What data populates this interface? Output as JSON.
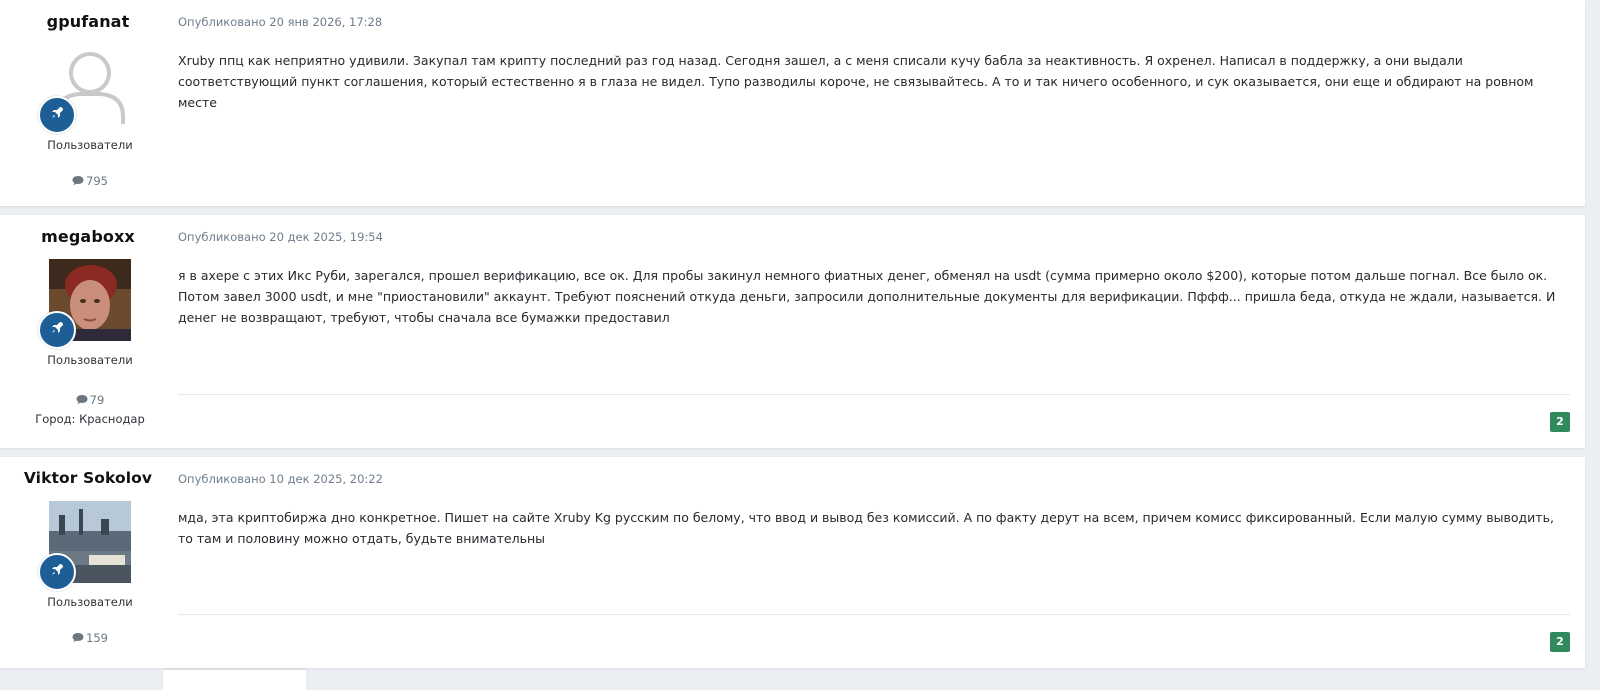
{
  "posts": [
    {
      "author": "gpufanat",
      "avatar": "default-avatar",
      "badge_icon": "rocket-icon",
      "group": "Пользователи",
      "post_count": "795",
      "city": "",
      "date": "Опубликовано 20 янв 2026, 17:28",
      "content": "Xruby ппц как неприятно удивили. Закупал там крипту последний раз год назад. Сегодня зашел, а с меня списали кучу бабла за неактивность. Я охренел. Написал в поддержку, а они выдали соответствующий пункт соглашения, который естественно я в глаза не видел. Тупо разводилы короче, не связывайтесь. А то и так ничего особенного, и сук оказывается, они еще и обдирают на ровном месте",
      "reactions": ""
    },
    {
      "author": "megaboxx",
      "avatar": "photo-avatar",
      "badge_icon": "rocket-icon",
      "group": "Пользователи",
      "post_count": "79",
      "city": "Город: Краснодар",
      "date": "Опубликовано 20 дек 2025, 19:54",
      "content": "я в ахере с этих Икс Руби, зарегался, прошел верификацию, все ок. Для пробы закинул немного фиатных денег, обменял на usdt (сумма примерно около $200), которые потом дальше погнал. Все было ок. Потом завел 3000 usdt, и мне \"приостановили\" аккаунт. Требуют пояснений откуда деньги, запросили дополнительные документы для верификации. Пффф... пришла беда, откуда не ждали, называется. И денег не возвращают, требуют, чтобы сначала все бумажки предоставил",
      "reactions": "2"
    },
    {
      "author": "Viktor Sokolov",
      "avatar": "photo-avatar",
      "badge_icon": "rocket-icon",
      "group": "Пользователи",
      "post_count": "159",
      "city": "",
      "date": "Опубликовано 10 дек 2025, 20:22",
      "content": "мда, эта криптобиржа дно конкретное. Пишет на сайте Xruby Kg русским по белому, что ввод и вывод без комиссий. А по факту дерут на всем, причем комисс фиксированный. Если малую сумму выводить, то там и половину можно отдать, будьте внимательны",
      "reactions": "2"
    }
  ],
  "colors": {
    "badge": "#1e5e97",
    "reaction": "#2f8a5c",
    "date": "#6f7d8c",
    "background": "#ebeef2"
  }
}
